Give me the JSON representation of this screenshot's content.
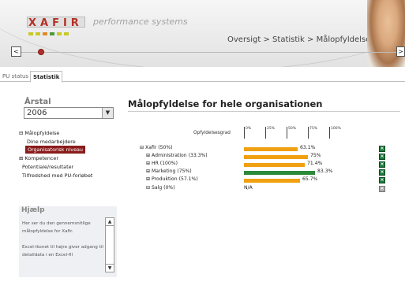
{
  "header": {
    "logo_text": "XAFIR",
    "tagline": "performance systems",
    "breadcrumb": "Oversigt > Statistik > Målopfyldelse",
    "nav_left": "<",
    "nav_right": ">",
    "accent": "#b3302a",
    "dot_colors": [
      "#c8c829",
      "#c8c829",
      "#e08a2a",
      "#4a9a3a",
      "#c8c829",
      "#c8c829"
    ]
  },
  "tabs": [
    {
      "label": "PU status",
      "active": false
    },
    {
      "label": "Statistik",
      "active": true
    }
  ],
  "sidebar": {
    "year_label": "Årstal",
    "year_value": "2006",
    "tree": [
      {
        "label": "Målopfyldelse",
        "prefix": "⊟"
      },
      {
        "label": "Dine medarbejdere",
        "prefix": ""
      },
      {
        "label": "Organisatorisk niveau",
        "prefix": "",
        "selected": true
      },
      {
        "label": "Kompetencer",
        "prefix": "⊞"
      },
      {
        "label": "Potentiale/resultater",
        "prefix": ""
      },
      {
        "label": "Tilfredshed med PU-forløbet",
        "prefix": ""
      }
    ],
    "help_title": "Hjælp",
    "help_text_1": "Her ser du den gennemsnitlige målopfyldelse for Xafir.",
    "help_text_2": "Excel-ikonet til højre giver adgang til detaildata i en Excel-fil"
  },
  "main": {
    "title": "Målopfyldelse for hele organisationen",
    "scale_label": "Opfyldelsesgrad",
    "scale_ticks": [
      "0%",
      "25%",
      "50%",
      "75%",
      "100%"
    ]
  },
  "chart_data": {
    "type": "bar",
    "orientation": "horizontal",
    "xlim": [
      0,
      100
    ],
    "rows": [
      {
        "label": "Xafir (50%)",
        "prefix": "⊟",
        "value": 63.1,
        "value_label": "63.1%",
        "color": "#f0a010"
      },
      {
        "label": "Administration (33.3%)",
        "prefix": "⊞",
        "value": 75,
        "value_label": "75%",
        "color": "#f0a010"
      },
      {
        "label": "HR (100%)",
        "prefix": "⊞",
        "value": 71.4,
        "value_label": "71.4%",
        "color": "#f0a010"
      },
      {
        "label": "Marketing (75%)",
        "prefix": "⊞",
        "value": 83.3,
        "value_label": "83.3%",
        "color": "#2a8a3a"
      },
      {
        "label": "Produktion (57.1%)",
        "prefix": "⊞",
        "value": 65.7,
        "value_label": "65.7%",
        "color": "#f0a010"
      },
      {
        "label": "Salg (0%)",
        "prefix": "⊟",
        "value": null,
        "value_label": "N/A",
        "color": "#f0a010"
      }
    ]
  }
}
